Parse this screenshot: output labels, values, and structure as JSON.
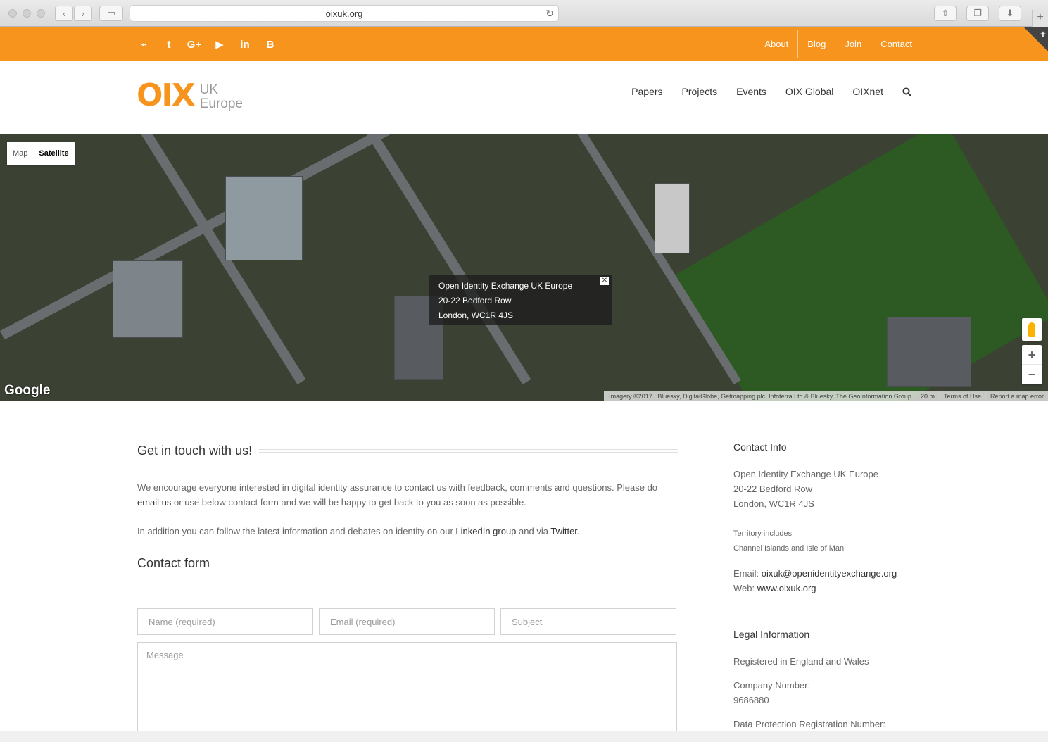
{
  "browser": {
    "url": "oixuk.org"
  },
  "topbar": {
    "social": [
      {
        "icon": "rss-icon",
        "glyph": "⌁"
      },
      {
        "icon": "twitter-icon",
        "glyph": "t"
      },
      {
        "icon": "google-plus-icon",
        "glyph": "G+"
      },
      {
        "icon": "youtube-icon",
        "glyph": "▶"
      },
      {
        "icon": "linkedin-icon",
        "glyph": "in"
      },
      {
        "icon": "blogger-icon",
        "glyph": "B"
      }
    ],
    "nav": [
      "About",
      "Blog",
      "Join",
      "Contact"
    ],
    "color": "#f7941d"
  },
  "header": {
    "logo_main": "OIX",
    "logo_sub_1": "UK",
    "logo_sub_2": "Europe",
    "nav": [
      "Papers",
      "Projects",
      "Events",
      "OIX Global",
      "OIXnet"
    ]
  },
  "map": {
    "type_map": "Map",
    "type_satellite": "Satellite",
    "info": {
      "line1": "Open Identity Exchange UK Europe",
      "line2": "20-22 Bedford Row",
      "line3": "London, WC1R 4JS"
    },
    "logo": "Google",
    "attribution": "Imagery ©2017 , Bluesky, DigitalGlobe, Getmapping plc, Infoterra Ltd & Bluesky, The GeoInformation Group",
    "scale": "20 m",
    "terms": "Terms of Use",
    "report": "Report a map error"
  },
  "main": {
    "title": "Get in touch with us!",
    "p1_a": "We encourage everyone interested in digital identity assurance to contact us with feedback, comments and questions.  Please do ",
    "p1_link": "email us",
    "p1_b": " or use below contact form and we will be happy to get back to you as soon as possible.",
    "p2_a": "In addition you can follow the latest information and debates on identity on our ",
    "p2_link1": "LinkedIn group",
    "p2_b": " and via ",
    "p2_link2": "Twitter",
    "p2_c": ".",
    "form_title": "Contact form",
    "name_ph": "Name (required)",
    "email_ph": "Email (required)",
    "subject_ph": "Subject",
    "message_ph": "Message"
  },
  "sidebar": {
    "contact_title": "Contact Info",
    "addr1": "Open Identity Exchange UK Europe",
    "addr2": "20-22 Bedford Row",
    "addr3": "London, WC1R 4JS",
    "territory1": "Territory includes",
    "territory2": "Channel Islands and Isle of Man",
    "email_label": "Email: ",
    "email": "oixuk@openidentityexchange.org",
    "web_label": "Web: ",
    "web": "www.oixuk.org",
    "legal_title": "Legal Information",
    "registered": "Registered in England and Wales",
    "company_label": "Company Number:",
    "company_number": "9686880",
    "dp_label": "Data Protection Registration Number:"
  }
}
